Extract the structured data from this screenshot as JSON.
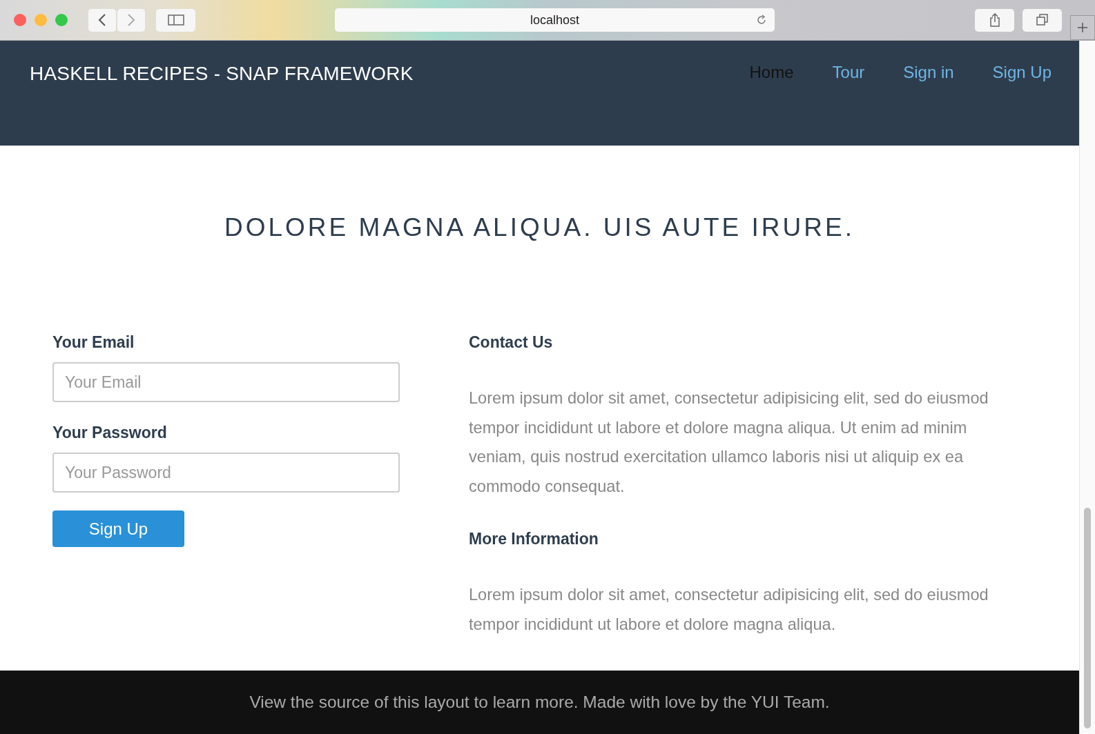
{
  "browser": {
    "address": "localhost"
  },
  "navbar": {
    "brand": "HASKELL RECIPES - SNAP FRAMEWORK",
    "links": [
      {
        "label": "Home",
        "selected": true
      },
      {
        "label": "Tour",
        "selected": false
      },
      {
        "label": "Sign in",
        "selected": false
      },
      {
        "label": "Sign Up",
        "selected": false
      }
    ]
  },
  "headline": "DOLORE MAGNA ALIQUA. UIS AUTE IRURE.",
  "form": {
    "fields": [
      {
        "label": "Your Email",
        "placeholder": "Your Email"
      },
      {
        "label": "Your Password",
        "placeholder": "Your Password"
      }
    ],
    "button": "Sign Up"
  },
  "sections": [
    {
      "title": "Contact Us",
      "text": "Lorem ipsum dolor sit amet, consectetur adipisicing elit, sed do eiusmod tempor incididunt ut labore et dolore magna aliqua. Ut enim ad minim veniam, quis nostrud exercitation ullamco laboris nisi ut aliquip ex ea commodo consequat."
    },
    {
      "title": "More Information",
      "text": "Lorem ipsum dolor sit amet, consectetur adipisicing elit, sed do eiusmod tempor incididunt ut labore et dolore magna aliqua."
    }
  ],
  "footer": "View the source of this layout to learn more. Made with love by the YUI Team."
}
